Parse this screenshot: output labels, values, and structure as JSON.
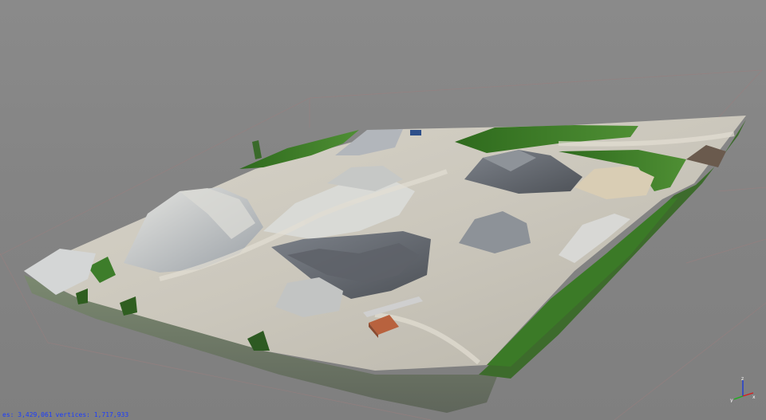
{
  "viewer": {
    "background_color": "#838383"
  },
  "status_bar": {
    "faces_text": "es: 3,429,061",
    "vertices_text": "vertices: 1,717,933",
    "text_color": "#1a3cff"
  },
  "axis_gizmo": {
    "x_label": "x",
    "y_label": "y",
    "z_label": "z",
    "x_color": "#d81b1b",
    "y_color": "#1bb01b",
    "z_color": "#1b3ad8"
  },
  "model": {
    "icon": "quarry-mesh-3d",
    "grass_color": "#3f7d2a",
    "gravel_color": "#c9c6bc",
    "rock_color": "#6f737a"
  }
}
